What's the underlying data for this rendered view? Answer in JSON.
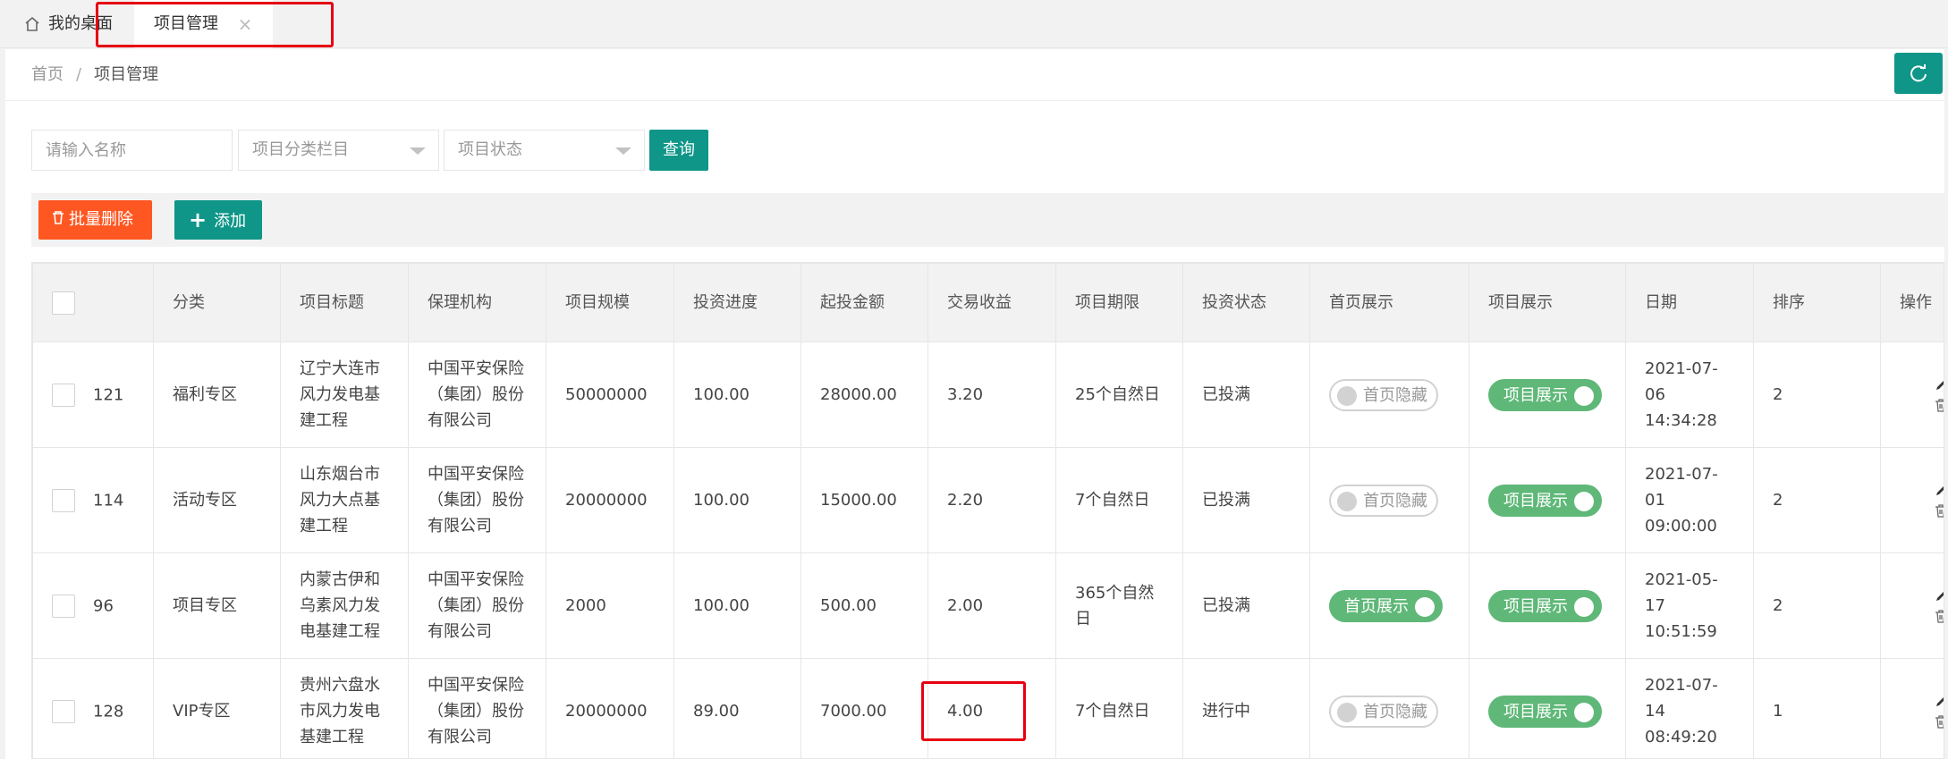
{
  "tabs": {
    "home_label": "我的桌面",
    "active_label": "项目管理",
    "close_glyph": "×"
  },
  "breadcrumb": {
    "home": "首页",
    "separator": "/",
    "current": "项目管理"
  },
  "search": {
    "name_placeholder": "请输入名称",
    "category_placeholder": "项目分类栏目",
    "status_placeholder": "项目状态",
    "query_label": "查询"
  },
  "toolbar": {
    "batch_delete_label": "批量删除",
    "add_label": "添加"
  },
  "table": {
    "headers": [
      "",
      "分类",
      "项目标题",
      "保理机构",
      "项目规模",
      "投资进度",
      "起投金额",
      "交易收益",
      "项目期限",
      "投资状态",
      "首页展示",
      "项目展示",
      "日期",
      "排序",
      "操作"
    ],
    "rows": [
      {
        "id": "121",
        "category": "福利专区",
        "title": "辽宁大连市风力发电基建工程",
        "institution": "中国平安保险（集团）股份有限公司",
        "scale": "50000000",
        "progress": "100.00",
        "min_amount": "28000.00",
        "yield": "3.20",
        "term": "25个自然日",
        "status": "已投满",
        "home_display": "首页隐藏",
        "home_display_on": false,
        "project_display": "项目展示",
        "project_display_on": true,
        "date": "2021-07-06 14:34:28",
        "sort": "2"
      },
      {
        "id": "114",
        "category": "活动专区",
        "title": "山东烟台市风力大点基建工程",
        "institution": "中国平安保险（集团）股份有限公司",
        "scale": "20000000",
        "progress": "100.00",
        "min_amount": "15000.00",
        "yield": "2.20",
        "term": "7个自然日",
        "status": "已投满",
        "home_display": "首页隐藏",
        "home_display_on": false,
        "project_display": "项目展示",
        "project_display_on": true,
        "date": "2021-07-01 09:00:00",
        "sort": "2"
      },
      {
        "id": "96",
        "category": "项目专区",
        "title": "内蒙古伊和乌素风力发电基建工程",
        "institution": "中国平安保险（集团）股份有限公司",
        "scale": "2000",
        "progress": "100.00",
        "min_amount": "500.00",
        "yield": "2.00",
        "term": "365个自然日",
        "status": "已投满",
        "home_display": "首页展示",
        "home_display_on": true,
        "project_display": "项目展示",
        "project_display_on": true,
        "date": "2021-05-17 10:51:59",
        "sort": "2"
      },
      {
        "id": "128",
        "category": "VIP专区",
        "title": "贵州六盘水市风力发电基建工程",
        "institution": "中国平安保险（集团）股份有限公司",
        "scale": "20000000",
        "progress": "89.00",
        "min_amount": "7000.00",
        "yield": "4.00",
        "term": "7个自然日",
        "status": "进行中",
        "home_display": "首页隐藏",
        "home_display_on": false,
        "project_display": "项目展示",
        "project_display_on": true,
        "date": "2021-07-14 08:49:20",
        "sort": "1"
      }
    ]
  },
  "colors": {
    "primary": "#0f9688",
    "danger": "#ff5722",
    "switch_on": "#5fb878",
    "annotation": "#e60012"
  },
  "icons": [
    "home-icon",
    "close-icon",
    "refresh-icon",
    "dropdown-arrow-icon",
    "trash-icon",
    "plus-icon",
    "edit-icon",
    "delete-icon"
  ]
}
